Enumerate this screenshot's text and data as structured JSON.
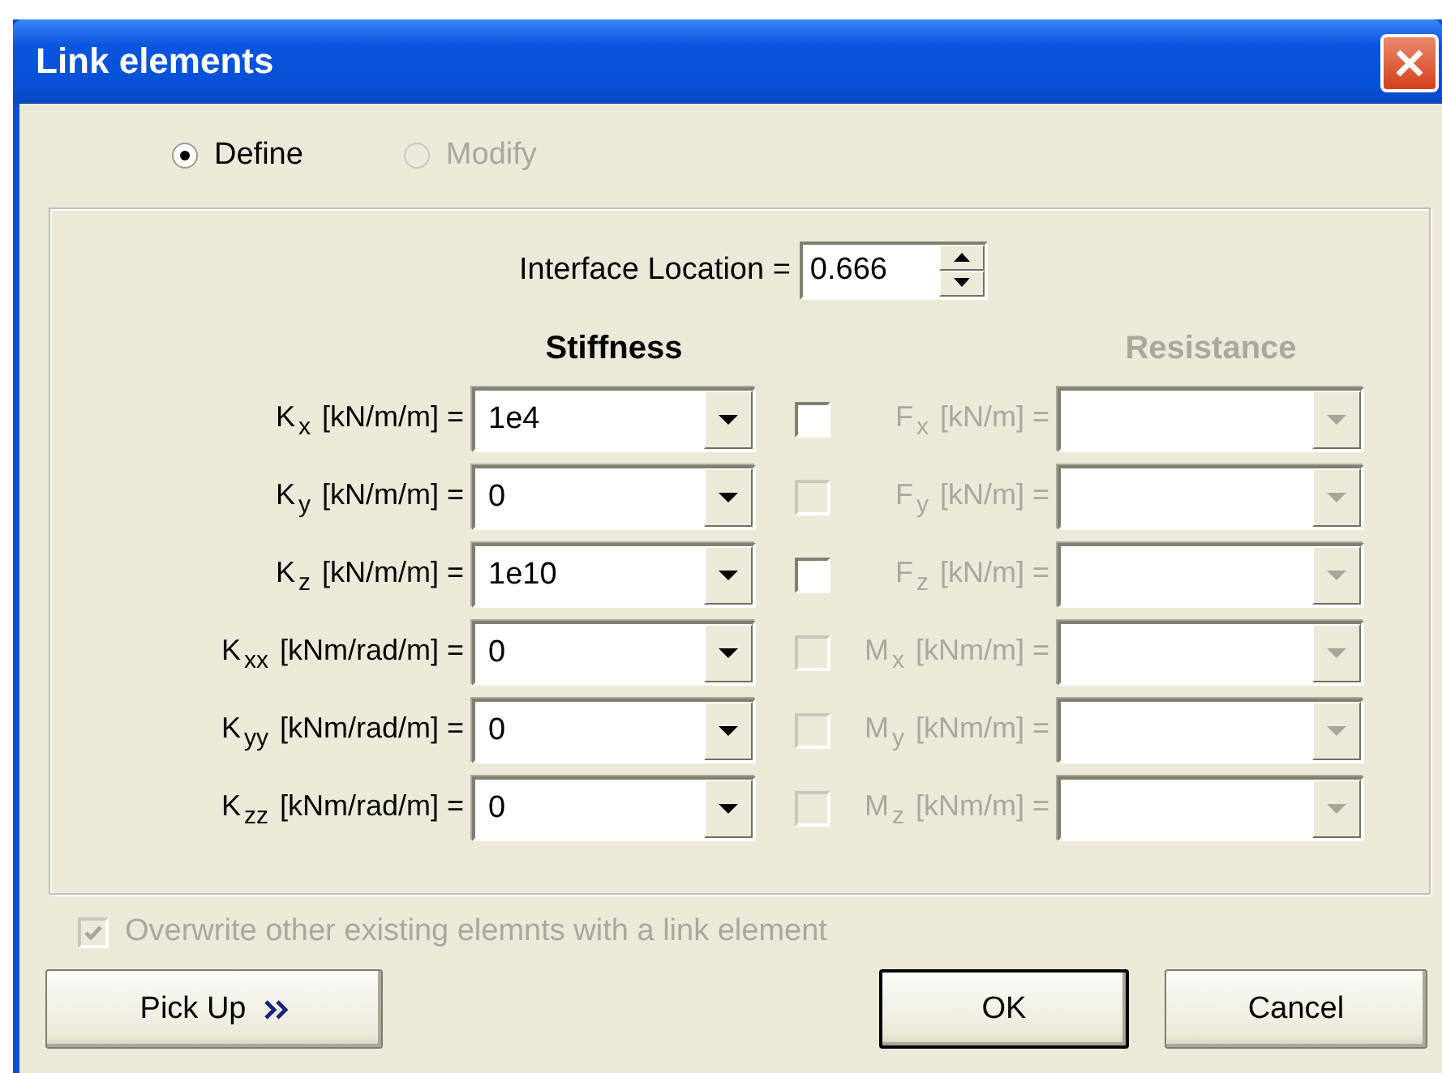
{
  "window": {
    "title": "Link elements"
  },
  "mode_options": [
    {
      "label": "Define",
      "selected": true,
      "disabled": false
    },
    {
      "label": "Modify",
      "selected": false,
      "disabled": true
    }
  ],
  "interface_location": {
    "label": "Interface Location =",
    "value": "0.666"
  },
  "stiffness_header": {
    "text": "Stiffness",
    "disabled": false
  },
  "resistance_header": {
    "text": "Resistance",
    "disabled": true
  },
  "rows": [
    {
      "stiffness_label": "K$_{x}$ [kN/m/m] =",
      "stiffness_value": "1e4",
      "checked": false,
      "check_disabled": false,
      "resistance_label": "F$_{x}$ [kN/m] =",
      "resistance_disabled": true
    },
    {
      "stiffness_label": "K$_{y}$ [kN/m/m] =",
      "stiffness_value": "0",
      "checked": false,
      "check_disabled": true,
      "resistance_label": "F$_{y}$ [kN/m] =",
      "resistance_disabled": true
    },
    {
      "stiffness_label": "K$_{z}$ [kN/m/m] =",
      "stiffness_value": "1e10",
      "checked": false,
      "check_disabled": false,
      "resistance_label": "F$_{z}$ [kN/m] =",
      "resistance_disabled": true
    },
    {
      "stiffness_label": "K$_{xx}$ [kNm/rad/m] =",
      "stiffness_value": "0",
      "checked": false,
      "check_disabled": true,
      "resistance_label": "M$_{x}$ [kNm/m] =",
      "resistance_disabled": true
    },
    {
      "stiffness_label": "K$_{yy}$ [kNm/rad/m] =",
      "stiffness_value": "0",
      "checked": false,
      "check_disabled": true,
      "resistance_label": "M$_{y}$ [kNm/m] =",
      "resistance_disabled": true
    },
    {
      "stiffness_label": "K$_{zz}$ [kNm/rad/m] =",
      "stiffness_value": "0",
      "checked": false,
      "check_disabled": true,
      "resistance_label": "M$_{z}$ [kNm/m] =",
      "resistance_disabled": true
    }
  ],
  "overwrite": {
    "label": "Overwrite other existing elemnts with a link element",
    "checked": true,
    "disabled": true
  },
  "buttons": [
    {
      "label": "Pick Up",
      "kind": "pickup",
      "default": false
    },
    {
      "label": "OK",
      "kind": "plain",
      "default": true
    },
    {
      "label": "Cancel",
      "kind": "plain",
      "default": false
    }
  ]
}
